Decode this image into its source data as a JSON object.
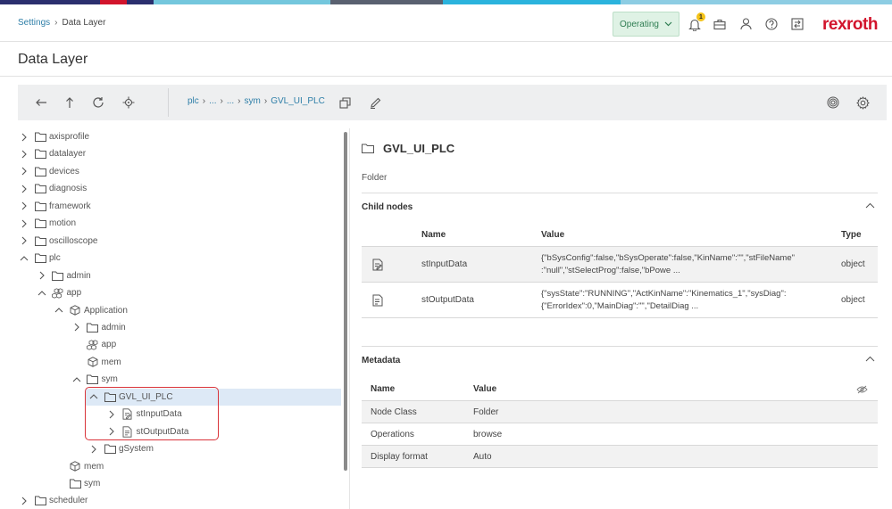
{
  "colors": {
    "strip": [
      "#2b2f6e",
      "#d2142c",
      "#2b2f6e",
      "#74c7dd",
      "#5a6170",
      "#2bb3dd",
      "#8dcde3"
    ],
    "brand": "#d2142c",
    "link": "#2f7fa8",
    "operating_bg": "#dff2e5",
    "selected_row": "#dde9f6",
    "highlight_border": "#d9343a"
  },
  "header": {
    "breadcrumb_root": "Settings",
    "breadcrumb_current": "Data Layer",
    "status": "Operating",
    "notification_count": "1",
    "brand": "rexroth",
    "icons": [
      "bell-icon",
      "briefcase-icon",
      "user-icon",
      "help-icon",
      "exit-icon"
    ]
  },
  "page": {
    "title": "Data Layer"
  },
  "toolbar": {
    "icons": [
      "back-arrow-icon",
      "up-arrow-icon",
      "refresh-icon",
      "target-icon",
      "copy-icon",
      "edit-icon",
      "fingerprint-icon",
      "settings-icon"
    ],
    "path": [
      "plc",
      "...",
      "...",
      "sym",
      "GVL_UI_PLC"
    ]
  },
  "tree": {
    "items": [
      {
        "label": "axisprofile",
        "level": 0,
        "expanded": false,
        "icon": "folder"
      },
      {
        "label": "datalayer",
        "level": 0,
        "expanded": false,
        "icon": "folder"
      },
      {
        "label": "devices",
        "level": 0,
        "expanded": false,
        "icon": "folder"
      },
      {
        "label": "diagnosis",
        "level": 0,
        "expanded": false,
        "icon": "folder"
      },
      {
        "label": "framework",
        "level": 0,
        "expanded": false,
        "icon": "folder"
      },
      {
        "label": "motion",
        "level": 0,
        "expanded": false,
        "icon": "folder"
      },
      {
        "label": "oscilloscope",
        "level": 0,
        "expanded": false,
        "icon": "folder"
      },
      {
        "label": "plc",
        "level": 0,
        "expanded": true,
        "icon": "folder"
      },
      {
        "label": "admin",
        "level": 1,
        "expanded": false,
        "icon": "folder"
      },
      {
        "label": "app",
        "level": 1,
        "expanded": true,
        "icon": "app"
      },
      {
        "label": "Application",
        "level": 2,
        "expanded": true,
        "icon": "cube"
      },
      {
        "label": "admin",
        "level": 3,
        "expanded": false,
        "icon": "folder"
      },
      {
        "label": "app",
        "level": 3,
        "expanded": null,
        "icon": "app"
      },
      {
        "label": "mem",
        "level": 3,
        "expanded": null,
        "icon": "cube"
      },
      {
        "label": "sym",
        "level": 3,
        "expanded": true,
        "icon": "folder"
      },
      {
        "label": "GVL_UI_PLC",
        "level": 4,
        "expanded": true,
        "icon": "folder",
        "selected": true
      },
      {
        "label": "stInputData",
        "level": 5,
        "expanded": false,
        "icon": "doc-edit"
      },
      {
        "label": "stOutputData",
        "level": 5,
        "expanded": false,
        "icon": "doc"
      },
      {
        "label": "gSystem",
        "level": 4,
        "expanded": false,
        "icon": "folder"
      },
      {
        "label": "mem",
        "level": 2,
        "expanded": null,
        "icon": "cube"
      },
      {
        "label": "sym",
        "level": 2,
        "expanded": null,
        "icon": "folder"
      },
      {
        "label": "scheduler",
        "level": 0,
        "expanded": false,
        "icon": "folder"
      }
    ]
  },
  "detail": {
    "title": "GVL_UI_PLC",
    "type": "Folder",
    "child_nodes": {
      "header": "Child nodes",
      "columns": {
        "name": "Name",
        "value": "Value",
        "type": "Type"
      },
      "rows": [
        {
          "name": "stInputData",
          "value_line1": "{\"bSysConfig\":false,\"bSysOperate\":false,\"KinName\":\"\",\"stFileName\"",
          "value_line2": ":\"null\",\"stSelectProg\":false,\"bPowe ...",
          "type": "object",
          "icon": "doc-edit"
        },
        {
          "name": "stOutputData",
          "value_line1": "{\"sysState\":\"RUNNING\",\"ActKinName\":\"Kinematics_1\",\"sysDiag\":",
          "value_line2": "{\"ErrorIdex\":0,\"MainDiag\":\"\",\"DetailDiag ...",
          "type": "object",
          "icon": "doc"
        }
      ]
    },
    "metadata": {
      "header": "Metadata",
      "columns": {
        "name": "Name",
        "value": "Value"
      },
      "rows": [
        {
          "name": "Node Class",
          "value": "Folder"
        },
        {
          "name": "Operations",
          "value": "browse"
        },
        {
          "name": "Display format",
          "value": "Auto"
        }
      ]
    }
  }
}
